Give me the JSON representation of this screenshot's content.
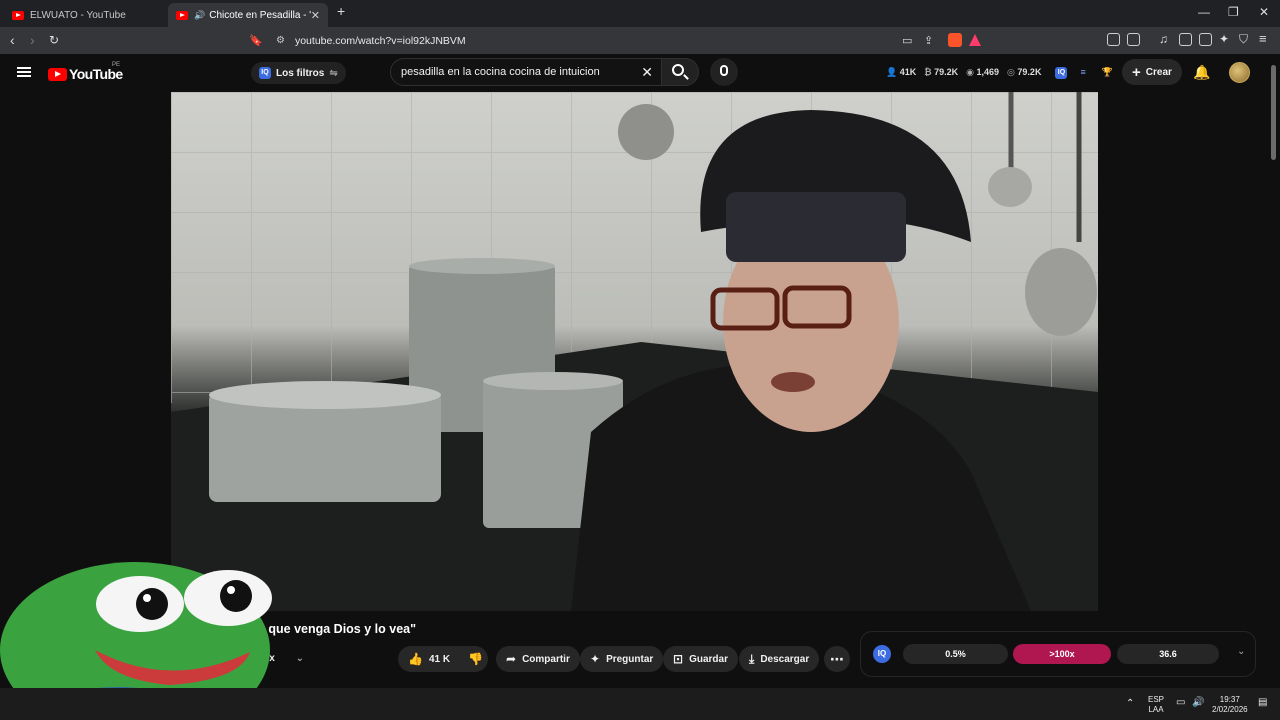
{
  "browser": {
    "tabs": [
      {
        "title": "ELWUATO - YouTube"
      },
      {
        "title": "Chicote en Pesadilla - \"Si esto...",
        "active": true
      }
    ],
    "new_tab": "+",
    "window_controls": {
      "minimize": "—",
      "restore": "❐",
      "close": "✕"
    },
    "url": "youtube.com/watch?v=iol92kJNBVM"
  },
  "youtube": {
    "logo_text": "YouTube",
    "country_code": "PE",
    "filters_label": "Los filtros",
    "search_value": "pesadilla en la cocina cocina de intuicion",
    "stats": [
      {
        "icon": "person-icon",
        "value": "41K"
      },
      {
        "icon": "coin-icon",
        "value": "79.2K"
      },
      {
        "icon": "eye-icon",
        "value": "1,469"
      },
      {
        "icon": "view-icon",
        "value": "79.2K"
      }
    ],
    "create_label": "Crear"
  },
  "video": {
    "title_visible": "ca que venga Dios y lo vea\"",
    "remix_label": "emix",
    "actions": {
      "like_count": "41 K",
      "share": "Compartir",
      "ask": "Preguntar",
      "save": "Guardar",
      "download": "Descargar"
    }
  },
  "extension_widget": {
    "left_value": "0.5%",
    "middle_value": ">100x",
    "right_value": "36.6",
    "accent_color": "#b0164f"
  },
  "taskbar": {
    "lang_top": "ESP",
    "lang_bottom": "LAA",
    "time": "19:37",
    "date": "2/02/2026"
  }
}
